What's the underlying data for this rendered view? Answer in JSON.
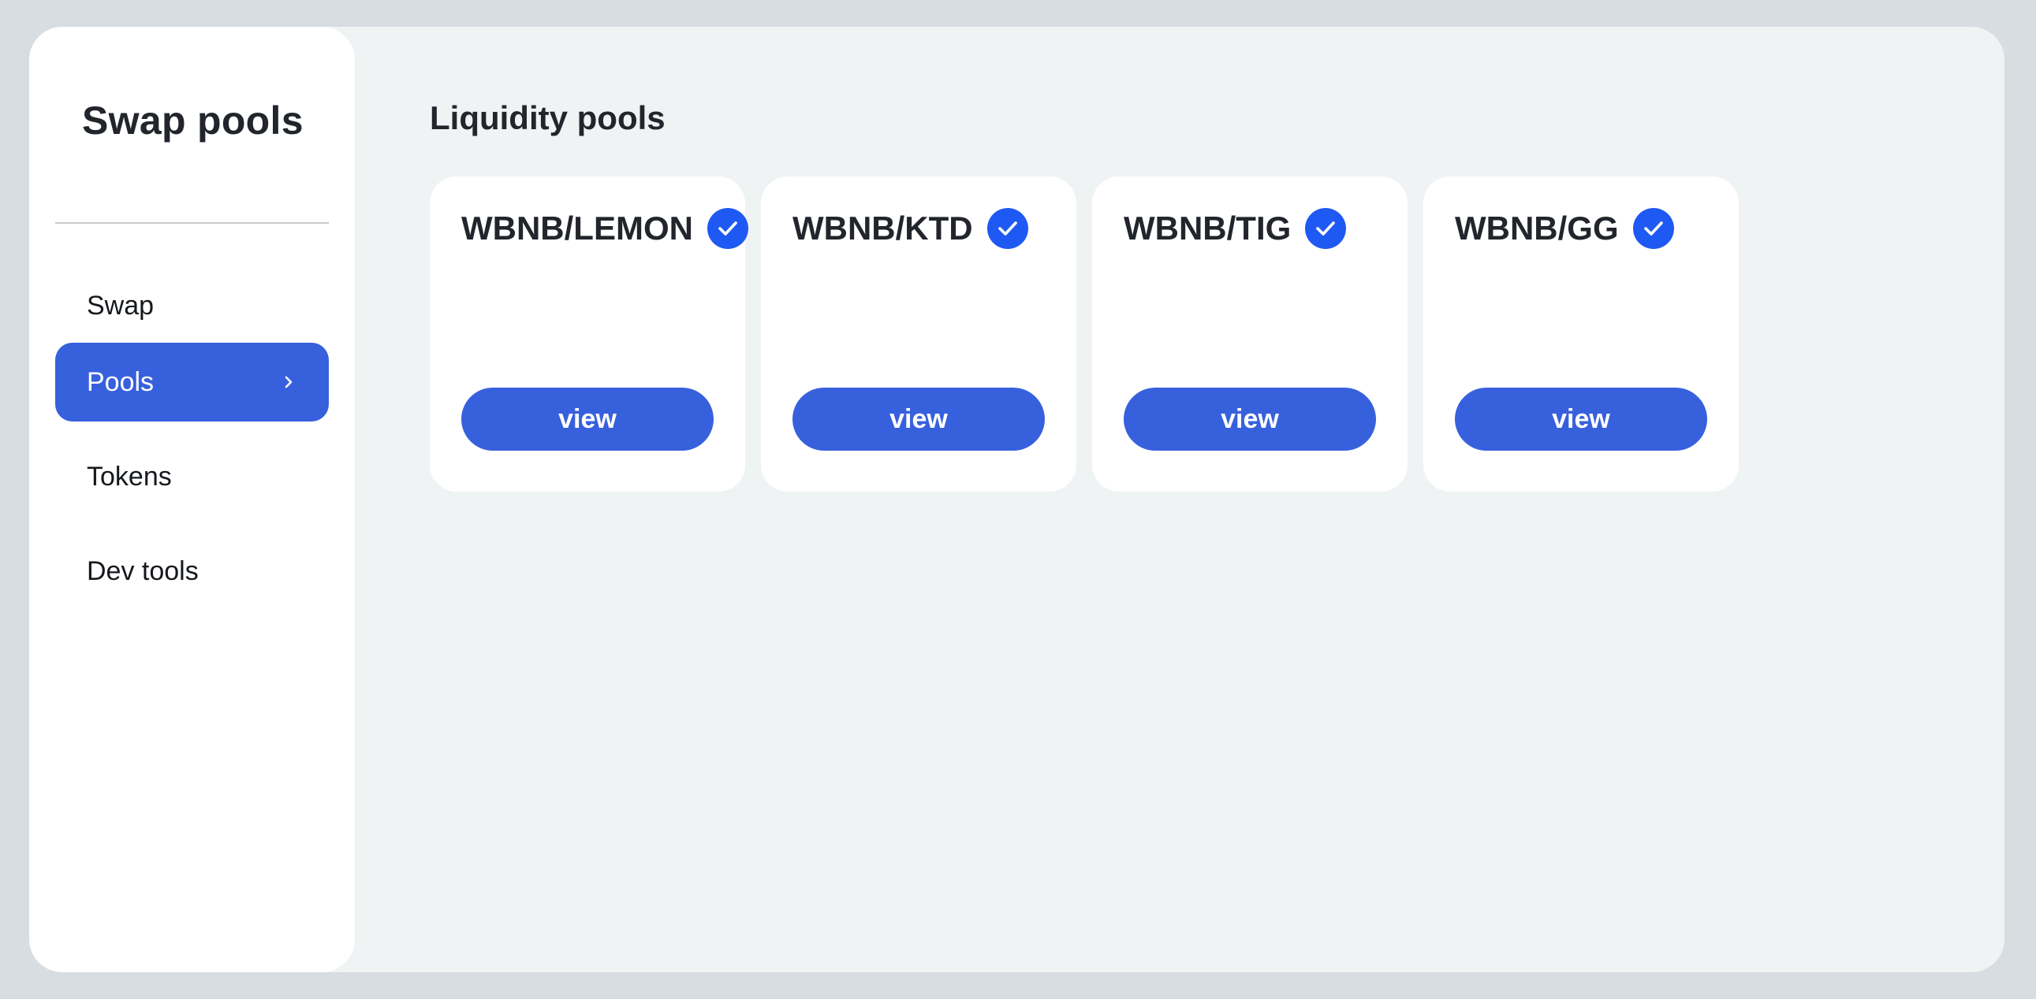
{
  "sidebar": {
    "title": "Swap pools",
    "items": [
      {
        "label": "Swap",
        "active": false
      },
      {
        "label": "Pools",
        "active": true
      },
      {
        "label": "Tokens",
        "active": false
      },
      {
        "label": "Dev tools",
        "active": false
      }
    ],
    "active_icon": "chevron-right-icon"
  },
  "main": {
    "title": "Liquidity pools",
    "pools": [
      {
        "pair": "WBNB/LEMON",
        "verified_icon": "check-circle-icon",
        "button_label": "view"
      },
      {
        "pair": "WBNB/KTD",
        "verified_icon": "check-circle-icon",
        "button_label": "view"
      },
      {
        "pair": "WBNB/TIG",
        "verified_icon": "check-circle-icon",
        "button_label": "view"
      },
      {
        "pair": "WBNB/GG",
        "verified_icon": "check-circle-icon",
        "button_label": "view"
      }
    ]
  },
  "colors": {
    "accent": "#3760dd",
    "verified": "#1f59f3",
    "page_background": "#d8dde1",
    "content_background": "#f0f3f4"
  }
}
